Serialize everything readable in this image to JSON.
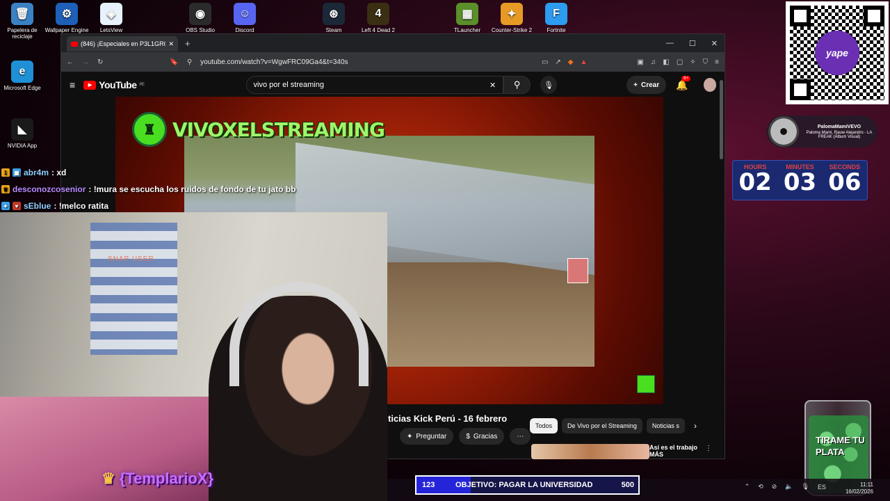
{
  "desktop": {
    "icons": [
      {
        "label": "Papelera de reciclaje",
        "icon": "recycle-bin-icon",
        "color": "#3b82c4",
        "glyph": "🗑"
      },
      {
        "label": "Wallpaper Engine",
        "icon": "wallpaper-engine-icon",
        "color": "#1e5fb8",
        "glyph": "⚙"
      },
      {
        "label": "LetsView",
        "icon": "letsview-icon",
        "color": "#e8f2fc",
        "glyph": "◈"
      },
      {
        "label": "OBS Studio",
        "icon": "obs-icon",
        "color": "#2b2b2b",
        "glyph": "◉"
      },
      {
        "label": "Discord",
        "icon": "discord-icon",
        "color": "#5865f2",
        "glyph": "☺"
      },
      {
        "label": "Steam",
        "icon": "steam-icon",
        "color": "#1b2838",
        "glyph": "⊛"
      },
      {
        "label": "Left 4 Dead 2",
        "icon": "left4dead2-icon",
        "color": "#3a2f12",
        "glyph": "4"
      },
      {
        "label": "TLauncher",
        "icon": "tlauncher-icon",
        "color": "#5a8f2a",
        "glyph": "▦"
      },
      {
        "label": "Counter-Strike 2",
        "icon": "cs2-icon",
        "color": "#e79a24",
        "glyph": "✦"
      },
      {
        "label": "Fortnite",
        "icon": "fortnite-icon",
        "color": "#2d9bf0",
        "glyph": "F"
      },
      {
        "label": "Microsoft Edge",
        "icon": "edge-icon",
        "color": "#1f8fd6",
        "glyph": "e"
      },
      {
        "label": "NVIDIA App",
        "icon": "nvidia-icon",
        "color": "#1a1a1a",
        "glyph": "◣"
      }
    ]
  },
  "browser": {
    "tab_title": "(846) ¡Especiales en P3L1GRO",
    "url": "youtube.com/watch?v=WgwFRC09Ga4&t=340s"
  },
  "youtube": {
    "logo": "YouTube",
    "region": "PE",
    "search_query": "vivo por el streaming",
    "create_label": "Crear",
    "notif_count": "9+",
    "channel_banner": "VIVOXELSTREAMING",
    "video_title": "ticias Kick Perú - 16 febrero",
    "actions": [
      "Preguntar",
      "Gracias"
    ],
    "chips": [
      "Todos",
      "De Vivo por el Streaming",
      "Noticias s"
    ],
    "side_video_title": "Así es el trabajo MÁS"
  },
  "chat": [
    {
      "user": "abr4m",
      "message": ": xd"
    },
    {
      "user": "desconozcosenior",
      "message": ": !mura se escucha los ruidos de fondo de tu jato bb"
    },
    {
      "user": "sEblue",
      "message": ": !melco ratita"
    }
  ],
  "webcam": {
    "watermark": "SNAP USER",
    "name_tag": "{TemplarioX}"
  },
  "now_playing": {
    "channel": "PalomaMamiVEVO",
    "track": "Paloma Mami, Rauw Alejandro - LA FREAK (Álbum Visual)"
  },
  "timer": {
    "hours_label": "HOURS",
    "hours": "02",
    "minutes_label": "MINUTES",
    "minutes": "03",
    "seconds_label": "SECONDS",
    "seconds": "06"
  },
  "jar": {
    "text": "TIRAME TU PLATA"
  },
  "qr": {
    "brand": "yape"
  },
  "goal": {
    "current": "123",
    "label": "OBJETIVO: PAGAR LA UNIVERSIDAD",
    "target": "500",
    "progress_fraction": 0.246
  },
  "taskbar": {
    "time": "11:11",
    "date": "16/02/2026",
    "lang": "ES"
  }
}
